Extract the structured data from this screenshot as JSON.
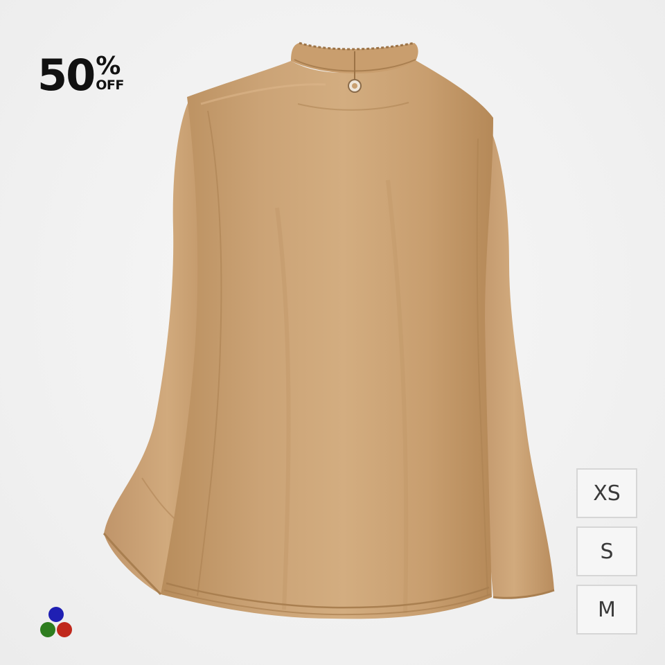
{
  "badge": {
    "number": "50",
    "percent": "%",
    "off": "OFF"
  },
  "product": {
    "garment_color": "#c9a071",
    "garment_shadow": "#a97f50",
    "garment_highlight": "#dcb68a"
  },
  "sizes": [
    {
      "label": "XS"
    },
    {
      "label": "S"
    },
    {
      "label": "M"
    }
  ],
  "colors": {
    "swatch_blue": "#1f1fb3",
    "swatch_green": "#2e7d1f",
    "swatch_red": "#c0281c"
  }
}
